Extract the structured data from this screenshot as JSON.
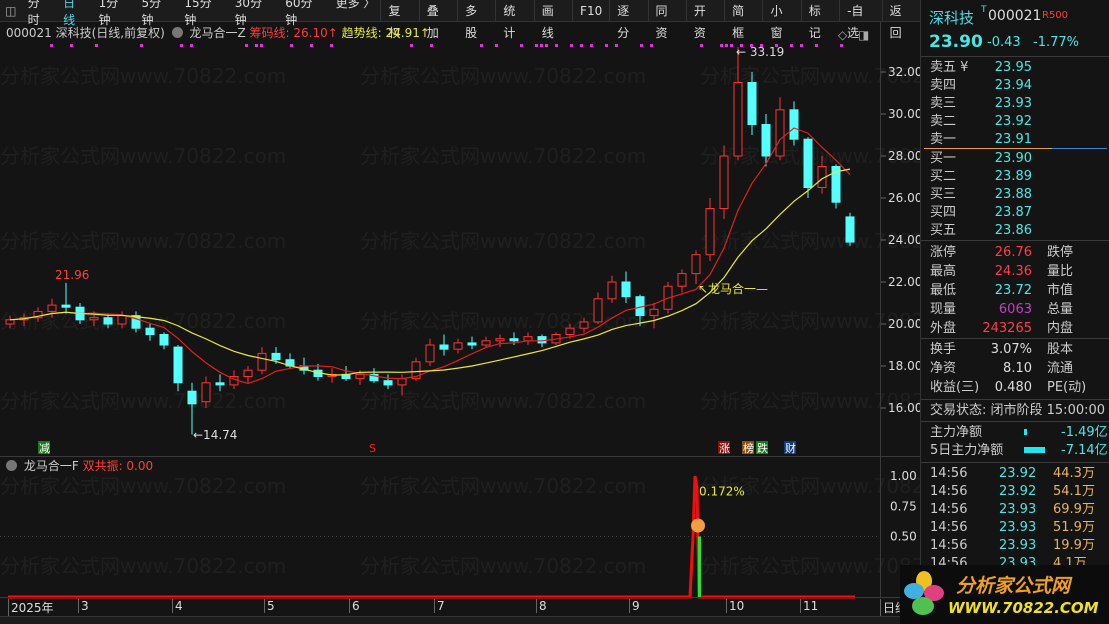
{
  "toolbar": {
    "periods": [
      "分时",
      "日线",
      "1分钟",
      "5分钟",
      "15分钟",
      "30分钟",
      "60分钟",
      "更多 〉"
    ],
    "active_period": "日线",
    "buttons": [
      "复权",
      "叠加",
      "多股",
      "统计",
      "画线",
      "F10",
      "逐分",
      "同资",
      "开资",
      "简框",
      "小窗",
      "标记",
      "-自选",
      "返回"
    ]
  },
  "chart": {
    "header": {
      "stock": "000021 深科技(日线,前复权)",
      "indicator": "龙马合一Z",
      "chip_label": "筹码线: 26.10↑",
      "trend_label": "趋势线: 24.91↑"
    },
    "price_axis": [
      "32.00",
      "30.00",
      "28.00",
      "26.00",
      "24.00",
      "22.00",
      "20.00",
      "18.00",
      "16.00"
    ],
    "annotations": {
      "high": "33.19",
      "low": "14.74",
      "peak_feb": "21.96",
      "indicator_label": "龙马合一"
    },
    "markers": [
      {
        "text": "减",
        "color": "#1a7a1a"
      },
      {
        "text": "S",
        "color": "#ff2020"
      },
      {
        "text": "涨",
        "color": "#8a1010"
      },
      {
        "text": "榜",
        "color": "#8a5010"
      },
      {
        "text": "跌",
        "color": "#1a7a1a"
      },
      {
        "text": "财",
        "color": "#103a7a"
      }
    ],
    "up_color": "#ff3232",
    "down_color": "#54ffff",
    "ma_fast_color": "#e02020",
    "ma_slow_color": "#e8e838",
    "candles": [
      [
        20.0,
        20.4,
        19.8,
        20.2
      ],
      [
        20.2,
        20.5,
        19.9,
        20.3
      ],
      [
        20.3,
        20.8,
        20.1,
        20.6
      ],
      [
        20.6,
        21.2,
        20.3,
        20.9
      ],
      [
        20.9,
        21.96,
        20.5,
        20.8
      ],
      [
        20.8,
        21.0,
        20.0,
        20.2
      ],
      [
        20.2,
        20.6,
        19.9,
        20.3
      ],
      [
        20.3,
        20.5,
        19.8,
        20.0
      ],
      [
        20.0,
        20.6,
        19.8,
        20.4
      ],
      [
        20.4,
        20.6,
        19.6,
        19.8
      ],
      [
        19.8,
        20.0,
        19.2,
        19.5
      ],
      [
        19.5,
        19.6,
        18.8,
        19.0
      ],
      [
        18.9,
        19.0,
        16.8,
        17.2
      ],
      [
        16.8,
        17.2,
        14.74,
        16.2
      ],
      [
        16.3,
        17.5,
        16.0,
        17.2
      ],
      [
        17.2,
        17.6,
        16.8,
        17.1
      ],
      [
        17.1,
        17.8,
        16.9,
        17.5
      ],
      [
        17.5,
        18.0,
        17.2,
        17.8
      ],
      [
        17.8,
        18.9,
        17.6,
        18.6
      ],
      [
        18.6,
        18.9,
        18.1,
        18.3
      ],
      [
        18.3,
        18.6,
        17.9,
        18.0
      ],
      [
        18.0,
        18.4,
        17.6,
        17.8
      ],
      [
        17.8,
        18.1,
        17.3,
        17.5
      ],
      [
        17.5,
        17.9,
        17.2,
        17.6
      ],
      [
        17.6,
        18.0,
        17.3,
        17.4
      ],
      [
        17.4,
        17.8,
        17.1,
        17.6
      ],
      [
        17.6,
        17.9,
        17.2,
        17.3
      ],
      [
        17.3,
        17.6,
        16.9,
        17.1
      ],
      [
        17.1,
        17.6,
        16.6,
        17.4
      ],
      [
        17.4,
        18.4,
        17.3,
        18.2
      ],
      [
        18.2,
        19.3,
        18.0,
        19.0
      ],
      [
        19.0,
        19.5,
        18.5,
        18.8
      ],
      [
        18.8,
        19.3,
        18.6,
        19.1
      ],
      [
        19.1,
        19.4,
        18.8,
        19.0
      ],
      [
        19.0,
        19.4,
        18.9,
        19.2
      ],
      [
        19.2,
        19.5,
        18.9,
        19.3
      ],
      [
        19.3,
        19.6,
        19.0,
        19.2
      ],
      [
        19.2,
        19.6,
        19.0,
        19.4
      ],
      [
        19.4,
        19.5,
        18.9,
        19.1
      ],
      [
        19.1,
        19.6,
        19.0,
        19.5
      ],
      [
        19.5,
        20.0,
        19.3,
        19.8
      ],
      [
        19.8,
        20.3,
        19.6,
        20.1
      ],
      [
        20.1,
        21.5,
        20.0,
        21.2
      ],
      [
        21.2,
        22.3,
        21.0,
        22.0
      ],
      [
        22.0,
        22.5,
        21.0,
        21.3
      ],
      [
        21.3,
        21.4,
        19.9,
        20.4
      ],
      [
        20.4,
        21.0,
        19.8,
        20.7
      ],
      [
        20.7,
        22.0,
        20.5,
        21.8
      ],
      [
        21.8,
        22.6,
        21.5,
        22.4
      ],
      [
        22.4,
        23.5,
        21.9,
        23.3
      ],
      [
        23.3,
        26.0,
        23.0,
        25.5
      ],
      [
        25.5,
        28.5,
        25.0,
        28.0
      ],
      [
        28.0,
        33.19,
        27.8,
        31.5
      ],
      [
        31.5,
        32.0,
        29.0,
        29.5
      ],
      [
        29.5,
        30.0,
        27.5,
        28.0
      ],
      [
        28.0,
        30.8,
        27.8,
        30.2
      ],
      [
        30.2,
        30.6,
        28.5,
        28.8
      ],
      [
        28.8,
        28.9,
        26.0,
        26.5
      ],
      [
        26.5,
        28.0,
        26.2,
        27.5
      ],
      [
        27.5,
        27.6,
        25.5,
        25.8
      ],
      [
        25.1,
        25.3,
        23.72,
        23.9
      ]
    ]
  },
  "sub": {
    "indicator": "龙马合一F",
    "resonance_label": "双共振: 0.00",
    "axis": [
      "1.00",
      "0.75",
      "0.50"
    ],
    "annotation": "0.172%",
    "face_icon": "sad-face-icon"
  },
  "date_axis": [
    "2025年",
    "3",
    "4",
    "5",
    "6",
    "7",
    "8",
    "9",
    "10",
    "11",
    "日线"
  ],
  "quote": {
    "name": "深科技",
    "code": "000021",
    "badge": "R500",
    "price": "23.90",
    "change": "-0.43",
    "pct": "-1.77%",
    "asks": [
      {
        "label": "卖五 ¥",
        "price": "23.95"
      },
      {
        "label": "卖四",
        "price": "23.94"
      },
      {
        "label": "卖三",
        "price": "23.93"
      },
      {
        "label": "卖二",
        "price": "23.92"
      },
      {
        "label": "卖一",
        "price": "23.91"
      }
    ],
    "bids": [
      {
        "label": "买一",
        "price": "23.90"
      },
      {
        "label": "买二",
        "price": "23.89"
      },
      {
        "label": "买三",
        "price": "23.88"
      },
      {
        "label": "买四",
        "price": "23.87"
      },
      {
        "label": "买五",
        "price": "23.86"
      }
    ],
    "stats": [
      {
        "l": "涨停",
        "v": "26.76",
        "c": "red",
        "l2": "跌停"
      },
      {
        "l": "最高",
        "v": "24.36",
        "c": "red",
        "l2": "量比"
      },
      {
        "l": "最低",
        "v": "23.72",
        "c": "cyan",
        "l2": "市值"
      },
      {
        "l": "现量",
        "v": "6063",
        "c": "mag",
        "l2": "总量"
      },
      {
        "l": "外盘",
        "v": "243265",
        "c": "red",
        "l2": "内盘"
      }
    ],
    "stats2": [
      {
        "l": "换手",
        "v": "3.07%",
        "l2": "股本"
      },
      {
        "l": "净资",
        "v": "8.10",
        "l2": "流通"
      },
      {
        "l": "收益(三)",
        "v": "0.480",
        "l2": "PE(动)"
      }
    ],
    "status": "交易状态: 闭市阶段 15:00:00",
    "flow": [
      {
        "l": "主力净额",
        "v": "-1.49亿"
      },
      {
        "l": "5日主力净额",
        "v": "-7.14亿"
      }
    ],
    "ticks": [
      [
        "14:56",
        "23.92",
        "44.3万"
      ],
      [
        "14:56",
        "23.92",
        "54.1万"
      ],
      [
        "14:56",
        "23.93",
        "69.9万"
      ],
      [
        "14:56",
        "23.93",
        "51.9万"
      ],
      [
        "14:56",
        "23.93",
        "19.9万"
      ],
      [
        "14:56",
        "23.93",
        "4.1万"
      ]
    ]
  },
  "logo": {
    "text": "分析家公式网",
    "url": "WWW.70822.COM"
  },
  "watermark": "分析家公式网www.70822.com"
}
